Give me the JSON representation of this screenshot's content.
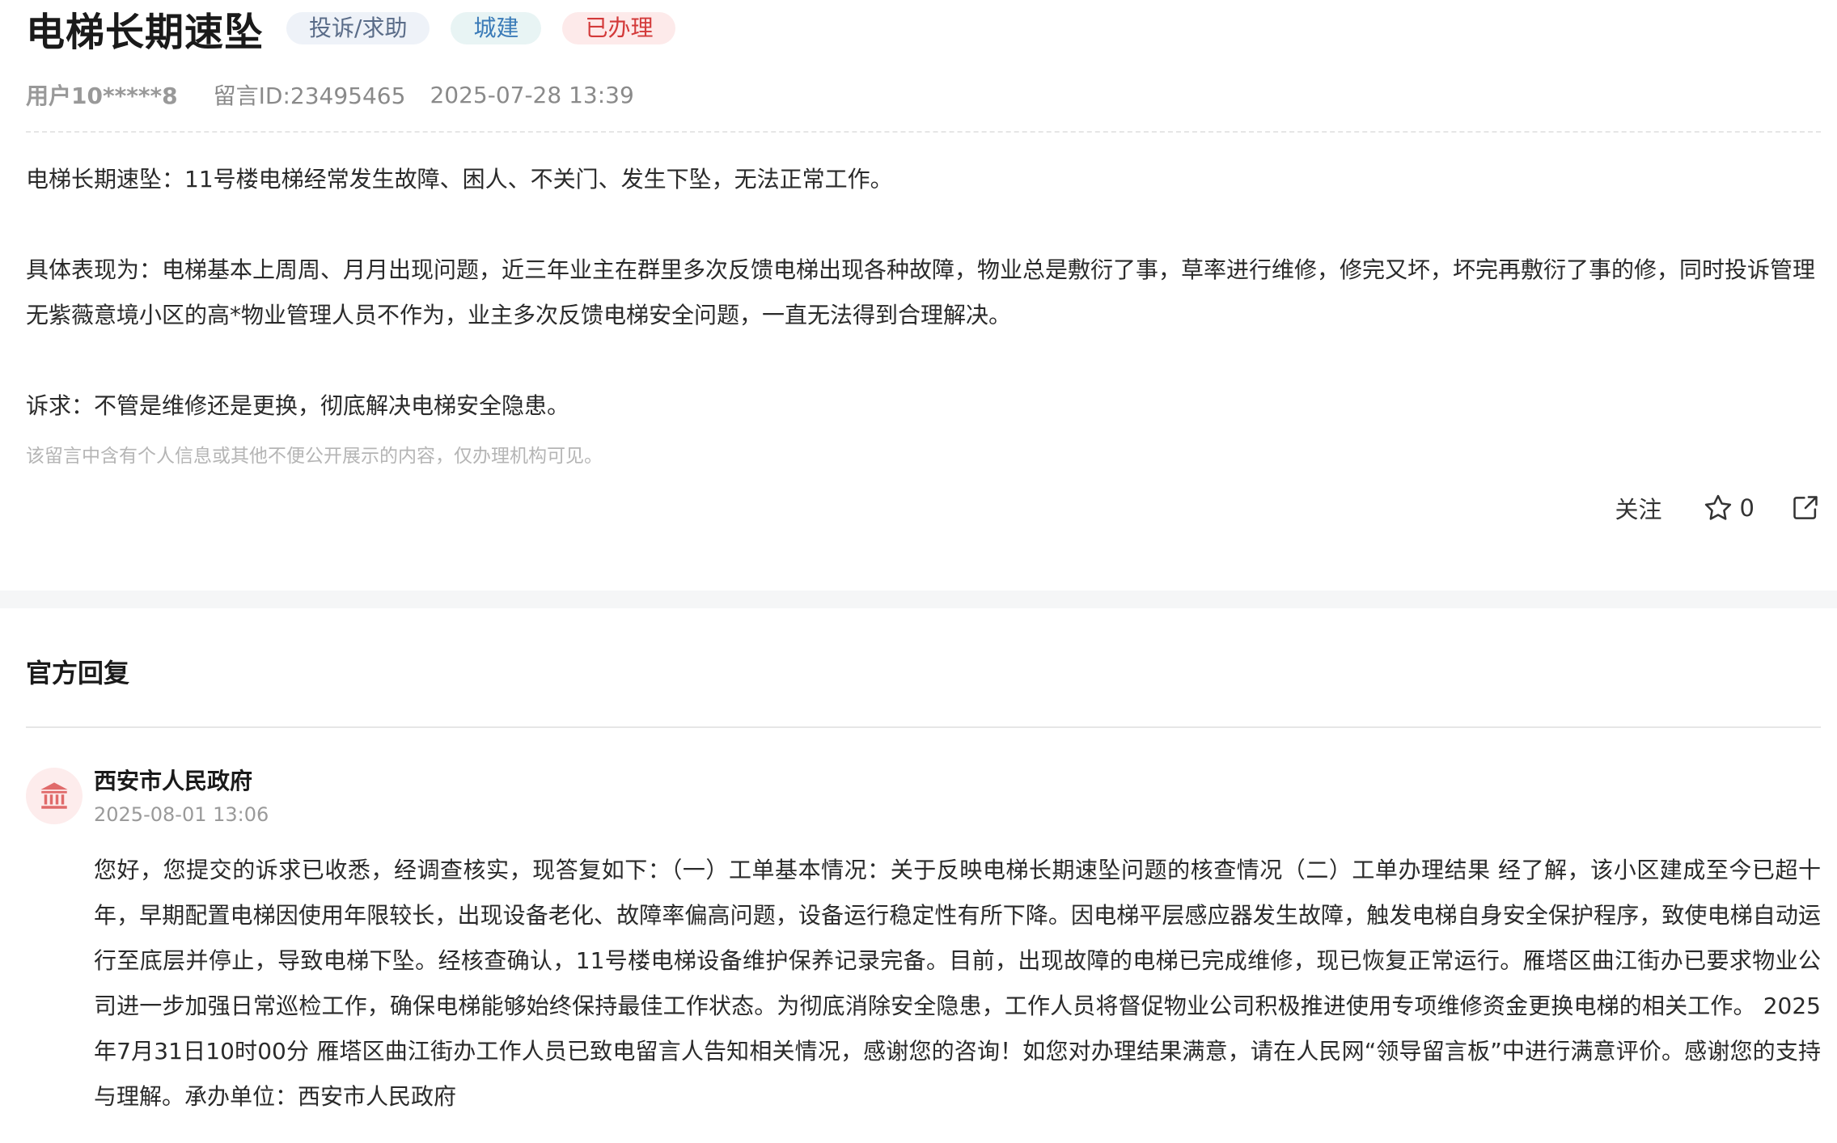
{
  "message": {
    "title": "电梯长期速坠",
    "tags": {
      "type": "投诉/求助",
      "domain": "城建",
      "status": "已办理"
    },
    "user": "用户10*****8",
    "message_id": "留言ID:23495465",
    "datetime": "2025-07-28 13:39",
    "paragraphs": [
      "电梯长期速坠：11号楼电梯经常发生故障、困人、不关门、发生下坠，无法正常工作。",
      "具体表现为：电梯基本上周周、月月出现问题，近三年业主在群里多次反馈电梯出现各种故障，物业总是敷衍了事，草率进行维修，修完又坏，坏完再敷衍了事的修，同时投诉管理无紫薇意境小区的高*物业管理人员不作为，业主多次反馈电梯安全问题，一直无法得到合理解决。",
      "诉求：不管是维修还是更换，彻底解决电梯安全隐患。"
    ],
    "privacy_notice": "该留言中含有个人信息或其他不便公开展示的内容，仅办理机构可见。"
  },
  "actions": {
    "follow_label": "关注",
    "star_count": "0",
    "star_icon": "star-outline-icon",
    "share_icon": "share-icon"
  },
  "reply": {
    "section_title": "官方回复",
    "org_name": "西安市人民政府",
    "org_icon": "government-building-icon",
    "datetime": "2025-08-01 13:06",
    "content": "您好，您提交的诉求已收悉，经调查核实，现答复如下：（一）工单基本情况：关于反映电梯长期速坠问题的核查情况（二）工单办理结果 经了解，该小区建成至今已超十年，早期配置电梯因使用年限较长，出现设备老化、故障率偏高问题，设备运行稳定性有所下降。因电梯平层感应器发生故障，触发电梯自身安全保护程序，致使电梯自动运行至底层并停止，导致电梯下坠。经核查确认，11号楼电梯设备维护保养记录完备。目前，出现故障的电梯已完成维修，现已恢复正常运行。雁塔区曲江街办已要求物业公司进一步加强日常巡检工作，确保电梯能够始终保持最佳工作状态。为彻底消除安全隐患，工作人员将督促物业公司积极推进使用专项维修资金更换电梯的相关工作。 2025年7月31日10时00分 雁塔区曲江街办工作人员已致电留言人告知相关情况，感谢您的咨询！如您对办理结果满意，请在人民网“领导留言板”中进行满意评价。感谢您的支持与理解。承办单位：西安市人民政府"
  },
  "colors": {
    "tag_type_bg": "#eef2f8",
    "tag_domain_bg": "#e8f4f4",
    "tag_status_bg": "#fdeaea",
    "status_red": "#d33a3a",
    "avatar_red": "#e06a6a"
  }
}
